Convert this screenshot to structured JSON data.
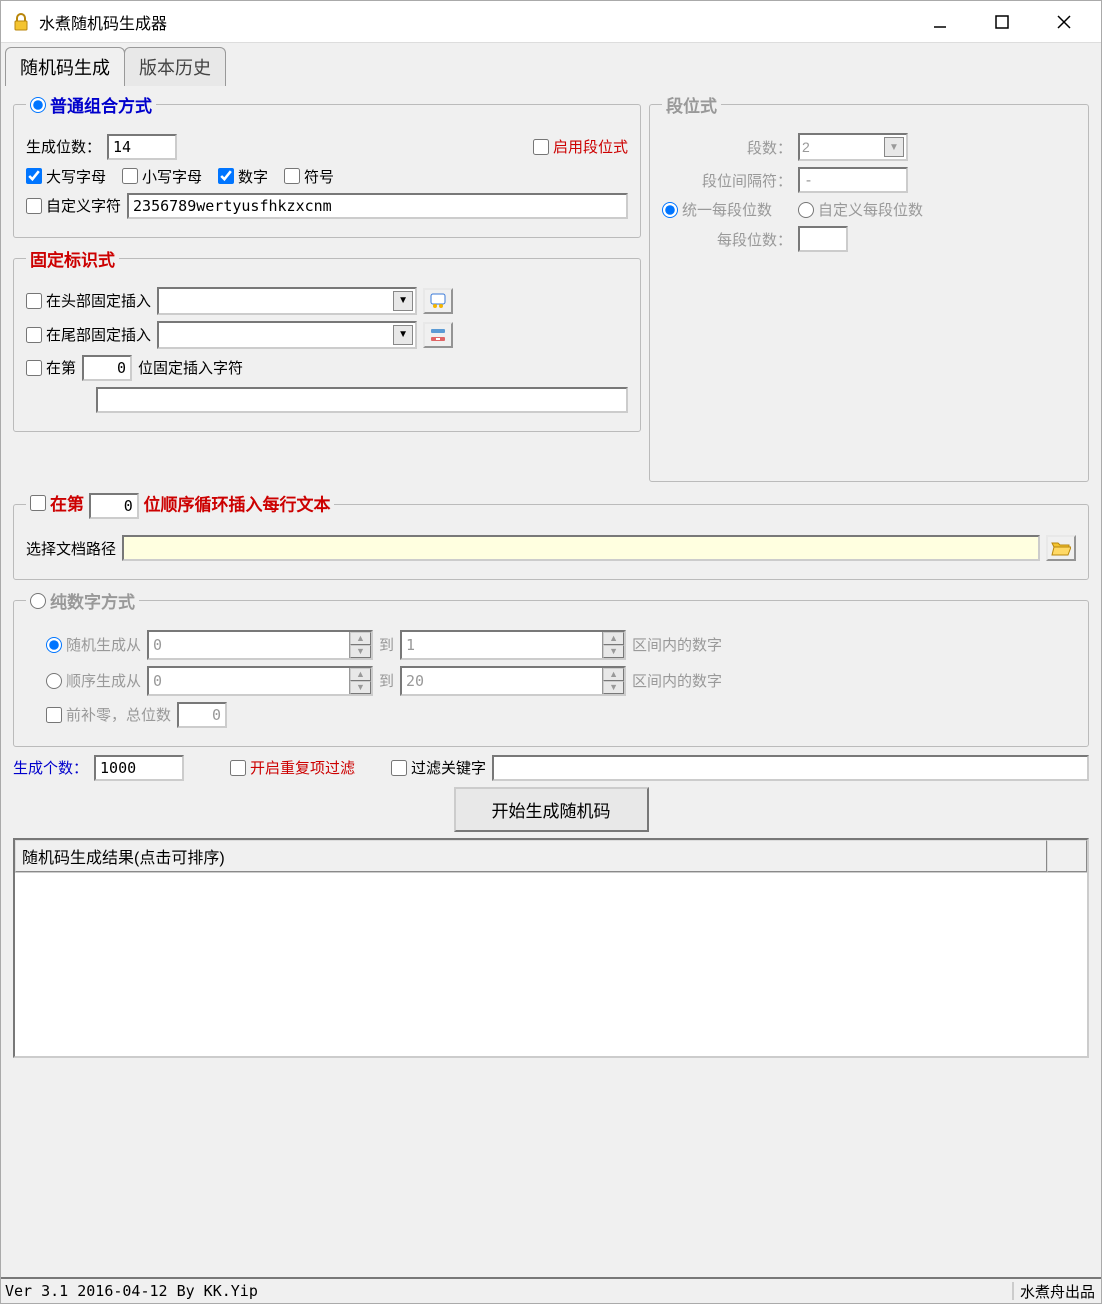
{
  "window": {
    "title": "水煮随机码生成器"
  },
  "tabs": {
    "tab1": "随机码生成",
    "tab2": "版本历史"
  },
  "combo": {
    "legend": "普通组合方式",
    "digits_label": "生成位数：",
    "digits_value": "14",
    "enable_segment": "启用段位式",
    "uppercase": "大写字母",
    "lowercase": "小写字母",
    "numbers": "数字",
    "symbols": "符号",
    "custom_label": "自定义字符",
    "custom_value": "2356789wertyusfhkzxcnm"
  },
  "segment": {
    "legend": "段位式",
    "count_label": "段数：",
    "count_value": "2",
    "sep_label": "段位间隔符：",
    "sep_value": "-",
    "uniform": "统一每段位数",
    "custom": "自定义每段位数",
    "per_label": "每段位数：",
    "per_value": ""
  },
  "fixed": {
    "legend": "固定标识式",
    "head": "在头部固定插入",
    "tail": "在尾部固定插入",
    "atpos_prefix": "在第",
    "atpos_value": "0",
    "atpos_suffix": "位固定插入字符",
    "atpos_text": ""
  },
  "loop": {
    "prefix": "在第",
    "pos": "0",
    "suffix": "位顺序循环插入每行文本",
    "path_label": "选择文档路径",
    "path_value": ""
  },
  "numeric": {
    "legend": "纯数字方式",
    "random_from": "随机生成从",
    "to": "到",
    "range_suffix": "区间内的数字",
    "seq_from": "顺序生成从",
    "r_from": "0",
    "r_to": "1",
    "s_from": "0",
    "s_to": "20",
    "pad_label": "前补零，总位数",
    "pad_value": "0"
  },
  "gen": {
    "count_label": "生成个数：",
    "count_value": "1000",
    "dup_filter": "开启重复项过滤",
    "kw_filter": "过滤关键字",
    "kw_value": "",
    "button": "开始生成随机码"
  },
  "results": {
    "header": "随机码生成结果(点击可排序)"
  },
  "status": {
    "left": "Ver 3.1 2016-04-12 By KK.Yip",
    "right": "水煮舟出品"
  }
}
